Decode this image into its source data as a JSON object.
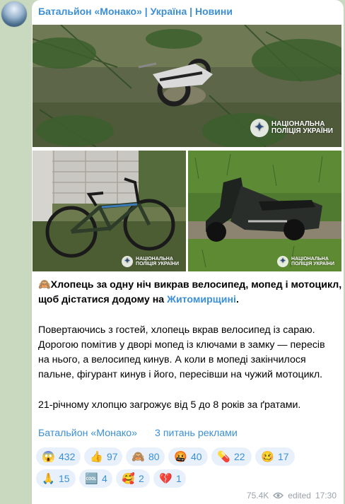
{
  "channel": {
    "name": "Батальйон «Монако» | Україна | Новини"
  },
  "watermark": {
    "line1": "НАЦІОНАЛЬНА",
    "line2": "ПОЛІЦІЯ УКРАЇНИ"
  },
  "post": {
    "headline_line1": "Хлопець за одну ніч викрав велосипед, мопед і мотоцикл,",
    "headline_line2_prefix": "щоб дістатися додому на ",
    "headline_link": "Житомирщині",
    "headline_suffix": ".",
    "body": [
      "Повертаючись з гостей, хлопець вкрав велосипед із сараю.",
      "Дорогою помітив у дворі мопед із ключами в замку — пересів",
      "на нього, а велосипед кинув. А коли в мопеді закінчилося",
      "пальне, фігурант кинув і його, пересівши на чужий мотоцикл."
    ],
    "sentence": "21-річному хлопцю загрожує від 5 до 8 років за ґратами."
  },
  "footer": {
    "link1": "Батальйон «Монако»",
    "link2": "3 питань реклами"
  },
  "reactions": [
    {
      "emoji": "😱",
      "icon": "screaming-face",
      "count": "432"
    },
    {
      "emoji": "👍",
      "icon": "thumbs-up",
      "count": "97"
    },
    {
      "emoji": "🙈",
      "icon": "see-no-evil-monkey",
      "count": "80"
    },
    {
      "emoji": "🤬",
      "icon": "cursing-face",
      "count": "40"
    },
    {
      "emoji": "💊",
      "icon": "pill",
      "count": "22"
    },
    {
      "emoji": "🥴",
      "icon": "woozy-face",
      "count": "17"
    },
    {
      "emoji": "🙏",
      "icon": "folded-hands",
      "count": "15"
    },
    {
      "emoji": "🆒",
      "icon": "cool-button",
      "count": "4"
    },
    {
      "emoji": "🥰",
      "icon": "smiling-face-with-hearts",
      "count": "2"
    },
    {
      "emoji": "💔",
      "icon": "broken-heart",
      "count": "1"
    }
  ],
  "meta": {
    "views": "75.4K",
    "status": "edited",
    "time": "17:30"
  }
}
